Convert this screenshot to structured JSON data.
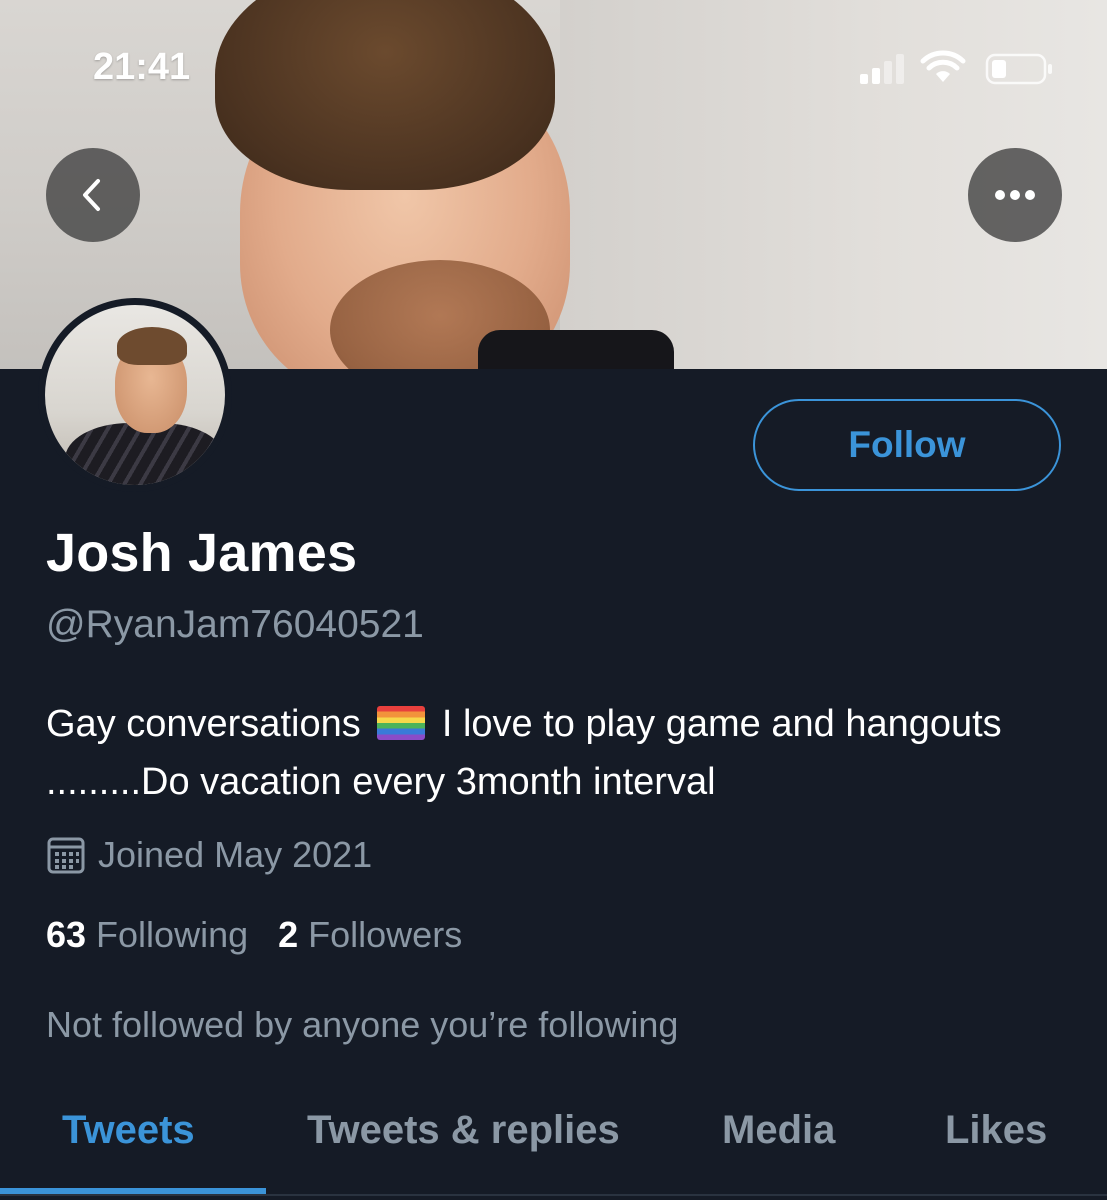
{
  "status_bar": {
    "time": "21:41",
    "icons": [
      "cellular-signal-icon",
      "wifi-icon",
      "battery-icon"
    ]
  },
  "nav": {
    "back_icon": "chevron-left-icon",
    "more_icon": "ellipsis-icon"
  },
  "profile": {
    "name": "Josh James",
    "handle": "@RyanJam76040521",
    "bio_part1": "Gay conversations",
    "bio_flag_icon": "rainbow-flag-icon",
    "bio_part2": "I love to play game and hangouts .........Do vacation every 3month interval",
    "joined": "Joined May 2021",
    "following_count": "63",
    "following_label": "Following",
    "followers_count": "2",
    "followers_label": "Followers",
    "mutuals_note": "Not followed by anyone you’re following"
  },
  "actions": {
    "follow_label": "Follow"
  },
  "tabs": [
    {
      "label": "Tweets",
      "active": true
    },
    {
      "label": "Tweets & replies",
      "active": false
    },
    {
      "label": "Media",
      "active": false
    },
    {
      "label": "Likes",
      "active": false
    }
  ],
  "colors": {
    "background": "#151b26",
    "accent": "#3b94d9",
    "secondary_text": "#8b98a5",
    "primary_text": "#ffffff"
  }
}
